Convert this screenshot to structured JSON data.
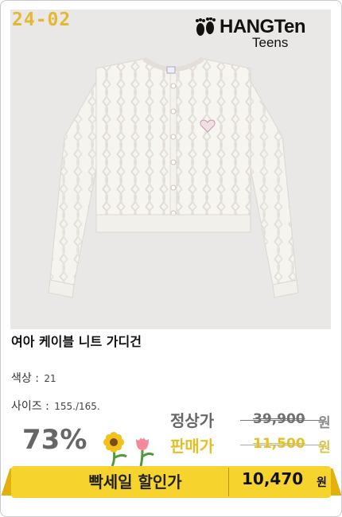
{
  "product": {
    "code": "24-02",
    "brand": {
      "main": "HANGTen",
      "sub": "Teens"
    },
    "image_icon": "cardigan-image",
    "title": "여아 케이블 니트 가디건",
    "color_label": "색상 :",
    "color_value": "21",
    "size_label": "사이즈 :",
    "size_value": "155./165."
  },
  "pricing": {
    "discount": "73%",
    "regular_label": "정상가",
    "regular_price": "39,900",
    "regular_unit": "원",
    "sale_label": "판매가",
    "sale_price": "11,500",
    "sale_unit": "원"
  },
  "banner": {
    "label": "빡세일 할인가",
    "price": "10,470",
    "unit": "원"
  },
  "colors": {
    "code": "#e4b92f",
    "banner": "#f7d42d",
    "sale": "#e6bf26",
    "discount": "#666666"
  }
}
